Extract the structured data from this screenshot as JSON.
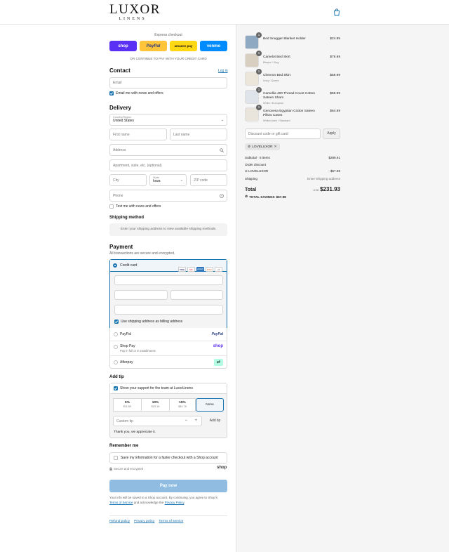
{
  "header": {
    "logo_main": "LUXOR",
    "logo_sub": "LINENS"
  },
  "express": {
    "title": "Express checkout",
    "buttons": [
      {
        "label": "shop",
        "bg": "#5a31f4",
        "fg": "#ffffff"
      },
      {
        "label": "PayPal",
        "bg": "#ffc439",
        "fg": "#253b80"
      },
      {
        "label": "amazon pay",
        "bg": "#ffd814",
        "fg": "#111111"
      },
      {
        "label": "venmo",
        "bg": "#008cff",
        "fg": "#ffffff"
      }
    ],
    "or_text": "OR CONTINUE TO PAY WITH YOUR CREDIT CARD"
  },
  "contact": {
    "title": "Contact",
    "login": "Log in",
    "email_placeholder": "Email",
    "news_label": "Email me with news and offers"
  },
  "delivery": {
    "title": "Delivery",
    "country_label": "Country/Region",
    "country_value": "United States",
    "first_name": "First name",
    "last_name": "Last name",
    "address": "Address",
    "apartment": "Apartment, suite, etc. (optional)",
    "city": "City",
    "state_label": "State",
    "state_value": "Iowa",
    "zip": "ZIP code",
    "phone": "Phone",
    "text_label": "Text me with news and offers"
  },
  "shipping": {
    "title": "Shipping method",
    "message": "Enter your shipping address to view available shipping methods."
  },
  "payment": {
    "title": "Payment",
    "subtitle": "All transactions are secure and encrypted.",
    "credit_card": "Credit card",
    "card_icons": [
      "VISA",
      "MC",
      "AMEX",
      "DISC",
      "+5"
    ],
    "billing_label": "Use shipping address as billing address",
    "paypal": "PayPal",
    "paypal_logo": "PayPal",
    "shop_pay": "Shop Pay",
    "shop_pay_sub": "Pay in full or in installments",
    "shop_logo": "shop",
    "afterpay": "Afterpay"
  },
  "tip": {
    "title": "Add tip",
    "support_label": "Show your support for the team at LuxorLinens",
    "options": [
      {
        "pct": "5%",
        "amt": "$11.60"
      },
      {
        "pct": "10%",
        "amt": "$23.19"
      },
      {
        "pct": "15%",
        "amt": "$34.79"
      }
    ],
    "none_label": "None",
    "custom_placeholder": "Custom tip",
    "minus": "−",
    "plus": "+",
    "add_button": "Add tip",
    "thanks": "Thank you, we appreciate it."
  },
  "remember": {
    "title": "Remember me",
    "save_label": "Save my information for a faster checkout with a Shop account",
    "secure": "Secure and encrypted",
    "shop_logo": "shop"
  },
  "pay_now": "Pay now",
  "legal": {
    "line1": "Your info will be saved to a Shop account. By continuing, you agree to Shop's",
    "terms": "Terms of Service",
    "and_ack": "and acknowledge the",
    "privacy": "Privacy Policy",
    "dot": "."
  },
  "footer_links": [
    "Refund policy",
    "Privacy policy",
    "Terms of service"
  ],
  "cart": {
    "items": [
      {
        "name": "Bed Snugger Blanket Holder",
        "variant": "",
        "price": "$24.95",
        "qty": "1",
        "color": "#8fa9c2"
      },
      {
        "name": "Camelot Bed Skirt",
        "variant": "Bisque / King",
        "price": "$79.99",
        "qty": "1",
        "color": "#d9cfc0"
      },
      {
        "name": "Chevron Bed Skirt",
        "variant": "Ivory / Queen",
        "price": "$59.99",
        "qty": "1",
        "color": "#ece6da"
      },
      {
        "name": "Camellia 400 Thread Count Cotton Sateen Sham",
        "variant": "White / European",
        "price": "$59.99",
        "qty": "1",
        "color": "#dfe4ea"
      },
      {
        "name": "Genovesa Egyptian Cotton Sateen Pillow Cases",
        "variant": "White/Linen / Standard",
        "price": "$64.99",
        "qty": "1",
        "color": "#e9e4dc"
      }
    ],
    "discount_placeholder": "Discount code or gift card",
    "apply": "Apply",
    "code_tag": "LOVELUXOR",
    "subtotal_label": "Subtotal · 5 items",
    "subtotal": "$289.91",
    "order_discount": "Order discount",
    "discount_code": "LOVELUXOR",
    "discount_value": "- $57.98",
    "shipping_label": "Shipping",
    "shipping_value": "Enter shipping address",
    "total_label": "Total",
    "currency": "USD",
    "total": "$231.93",
    "savings_label": "TOTAL SAVINGS",
    "savings": "$57.98"
  }
}
